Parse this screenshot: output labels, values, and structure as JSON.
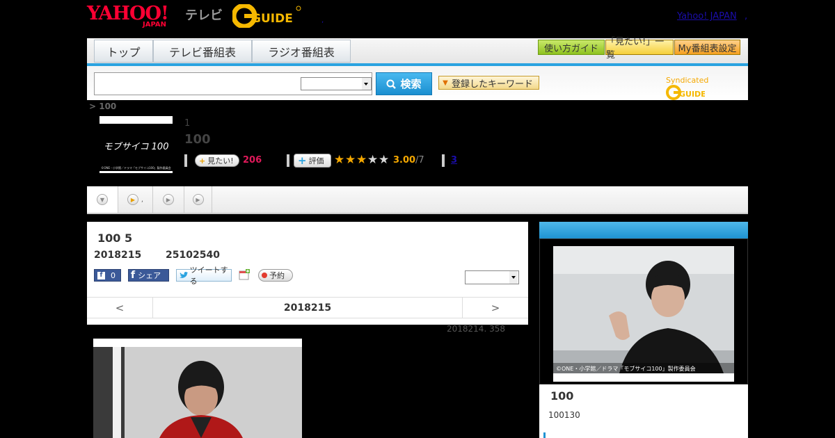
{
  "header": {
    "yahoo_logo": "YAHOO!",
    "yahoo_logo_sub": "JAPAN",
    "tv_label": "テレビ",
    "gguide_logo": "GUIDE",
    "yahoo_japan_link": "Yahoo! JAPAN",
    "dot_left": ",",
    "dot_right": ","
  },
  "nav": {
    "tabs": [
      {
        "label": "トップ"
      },
      {
        "label": "テレビ番組表"
      },
      {
        "label": "ラジオ番組表"
      }
    ],
    "buttons": [
      {
        "label": "使い方ガイド"
      },
      {
        "label": "「見たい!」一覧"
      },
      {
        "label": "My番組表設定"
      }
    ]
  },
  "search": {
    "placeholder": "",
    "button_label": "検索",
    "keyword_button": "登録したキーワード",
    "syndicated": "Syndicated"
  },
  "program": {
    "breadcrumb": "> 100",
    "thumbnail_text": "モブサイコ 100",
    "thumbnail_credit": "©ONE・小学館／ドラマ「モブサイコ100」製作委員会",
    "episode_number": "1",
    "title": "100",
    "want_label": "見たい!",
    "want_count": "206",
    "rating_label": "評価",
    "rating_value": "3.00",
    "rating_count": "/7",
    "stars_filled": 3,
    "review_count": "3"
  },
  "tabs_strip": {
    "tab2_suffix": ","
  },
  "episode": {
    "heading": "100 5",
    "date": "2018215",
    "time": "25102540",
    "fb_like_count": "0",
    "fb_share_label": "シェア",
    "tweet_label": "ツイートする",
    "reserve_label": "予約",
    "nav_prev": "<",
    "nav_date": "2018215",
    "nav_next": ">",
    "update_note": "2018214. 358"
  },
  "sidebar": {
    "photo_credit": "©ONE・小学館／ドラマ「モブサイコ100」製作委員会",
    "title": "100",
    "description": "100130"
  },
  "colors": {
    "accent_blue": "#2aa3e0",
    "want_pink": "#e0195a",
    "rating_orange": "#f5a800"
  }
}
